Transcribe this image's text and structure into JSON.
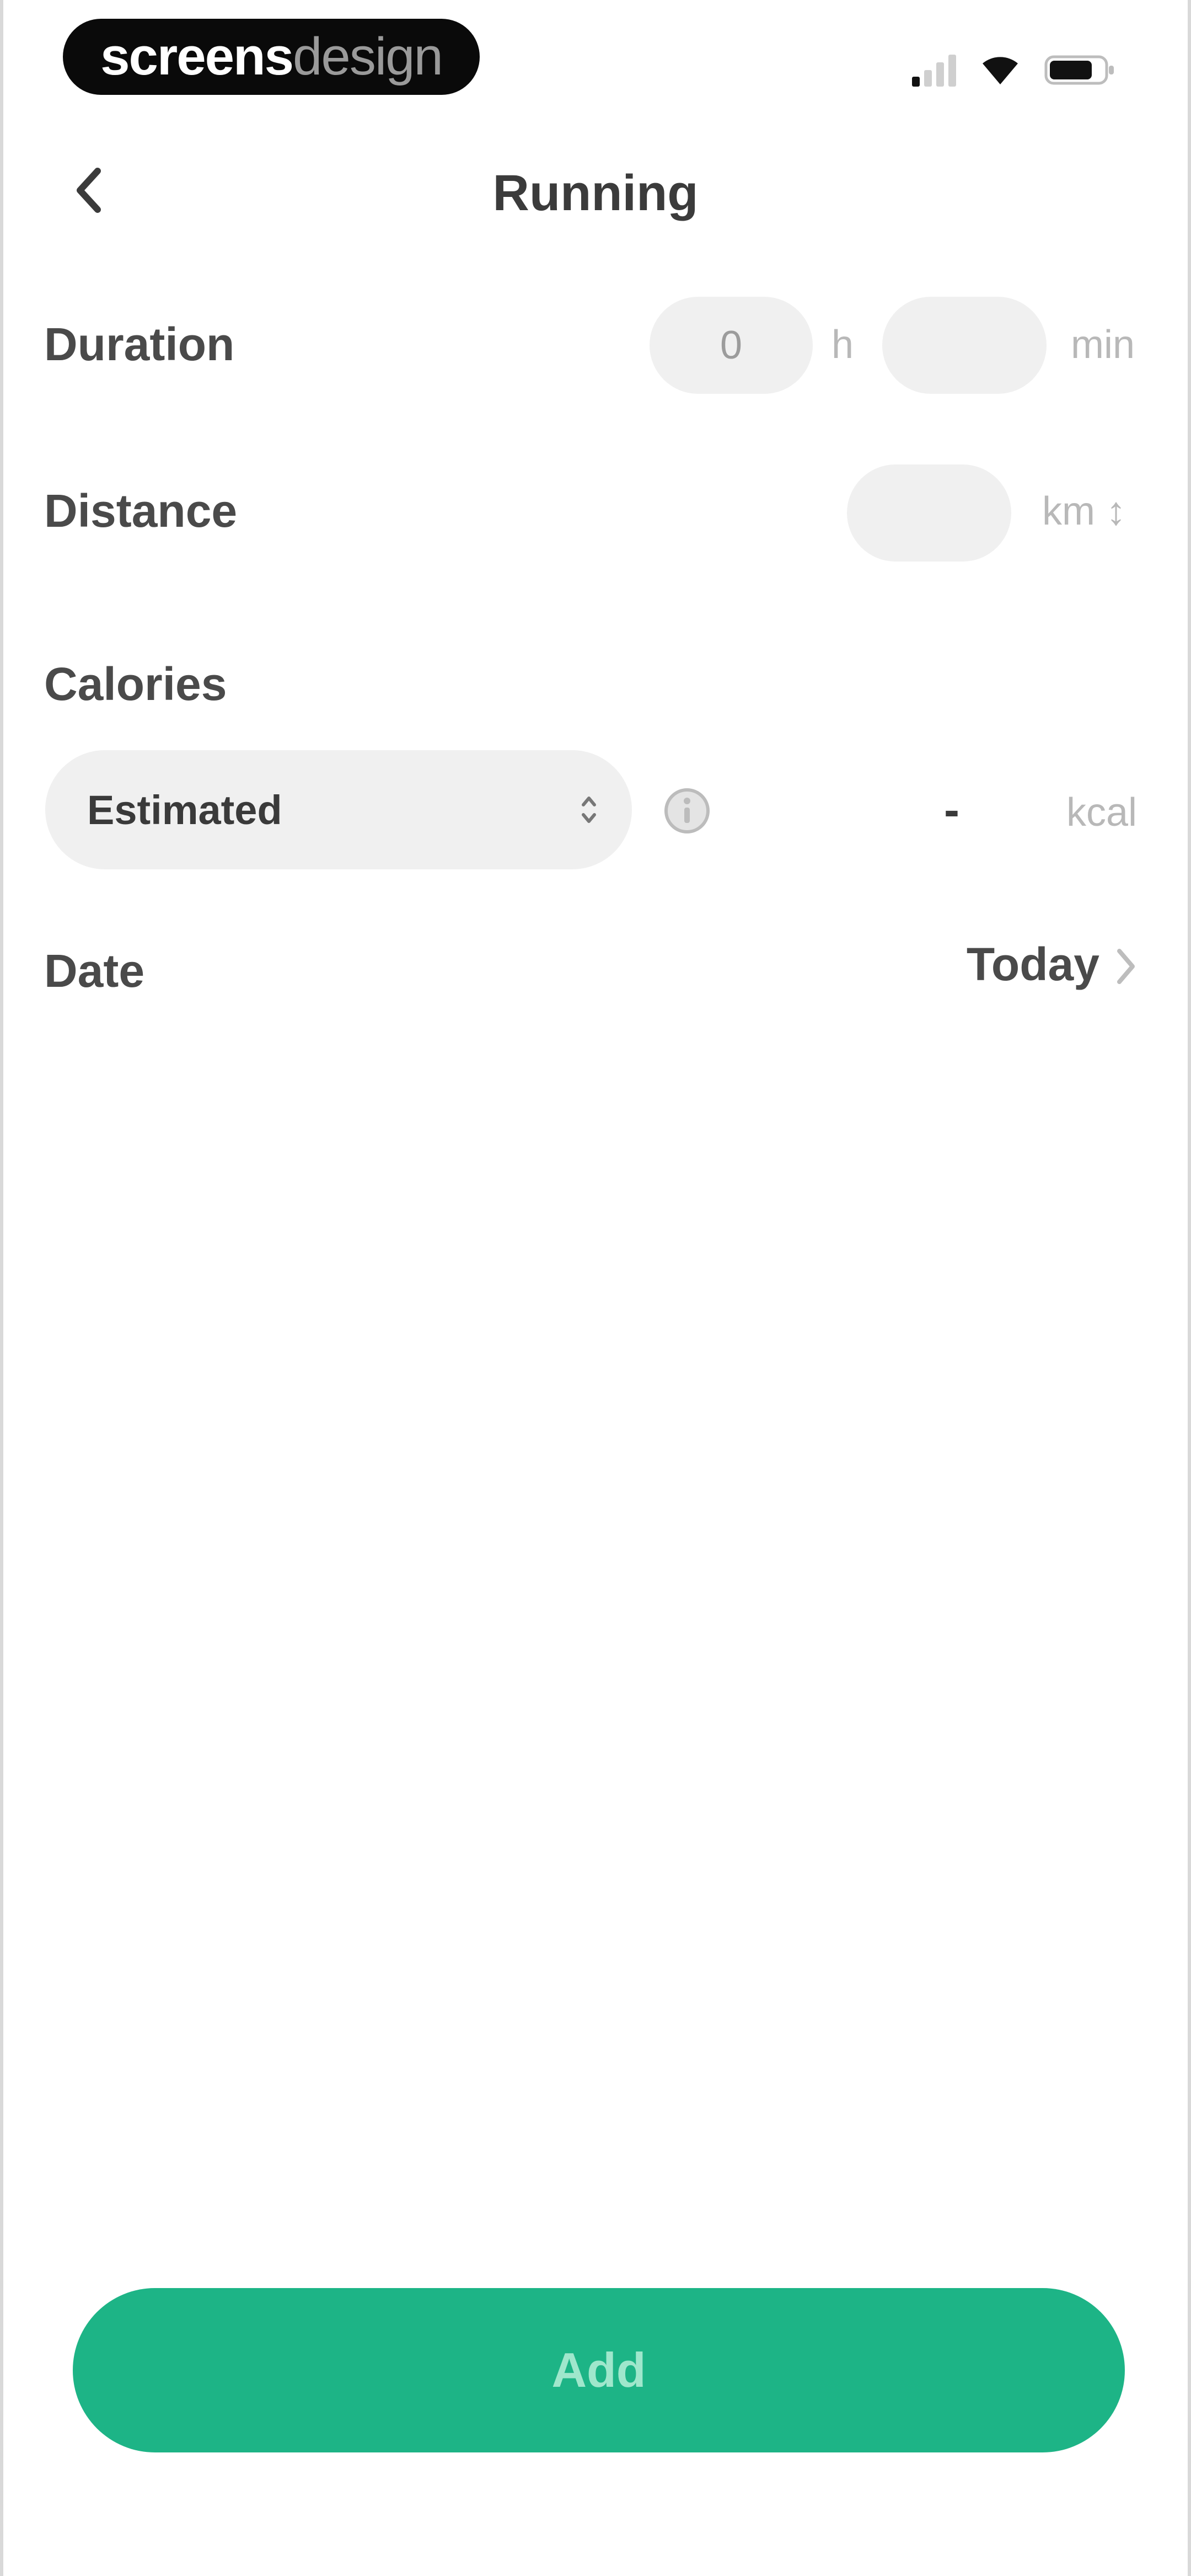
{
  "status_bar": {
    "watermark_bold": "screens",
    "watermark_light": "design",
    "icons": [
      "signal-icon",
      "wifi-icon",
      "battery-icon"
    ]
  },
  "header": {
    "back_icon": "chevron-left-icon",
    "title": "Running"
  },
  "form": {
    "duration": {
      "label": "Duration",
      "hours_value": "0",
      "hours_unit": "h",
      "minutes_value": "",
      "minutes_unit": "min"
    },
    "distance": {
      "label": "Distance",
      "value": "",
      "unit": "km ↕"
    },
    "calories": {
      "label": "Calories",
      "mode_selected": "Estimated",
      "mode_icon": "updown-chevron-icon",
      "info_icon": "info-icon",
      "value": "-",
      "unit": "kcal"
    },
    "date": {
      "label": "Date",
      "value": "Today",
      "chevron_icon": "chevron-right-icon"
    }
  },
  "actions": {
    "add_label": "Add"
  },
  "colors": {
    "accent": "#1db486",
    "accent_text": "#9fe7cc",
    "input_bg": "#f0f0f0",
    "label_text": "#4a4a4a",
    "muted_text": "#b8b8b8"
  }
}
